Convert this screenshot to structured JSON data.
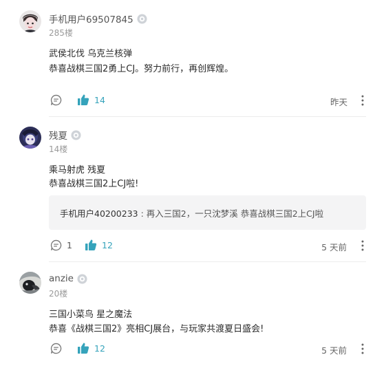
{
  "comments": [
    {
      "username": "手机用户69507845",
      "floor": "285楼",
      "lines": [
        "武侯北伐  乌克兰核弹",
        "恭喜战棋三国2勇上CJ。努力前行，再创辉煌。"
      ],
      "comment_count": "",
      "like_count": "14",
      "time": "昨天"
    },
    {
      "username": "残夏",
      "floor": "14楼",
      "lines": [
        "乘马射虎 残夏",
        "恭喜战棋三国2上CJ啦!"
      ],
      "quote": {
        "user": "手机用户40200233",
        "text": " : 再入三国2，一只沈梦溪 恭喜战棋三国2上CJ啦"
      },
      "comment_count": "1",
      "like_count": "12",
      "time": "5 天前"
    },
    {
      "username": "anzie",
      "floor": "20楼",
      "lines": [
        "三国小菜鸟  星之魔法",
        "恭喜《战棋三国2》亮相CJ展台，与玩家共渡夏日盛会!"
      ],
      "comment_count": "",
      "like_count": "12",
      "time": "5 天前"
    }
  ],
  "colors": {
    "accent": "#35a3bb",
    "divider": "#ececec",
    "quote_bg": "#f4f4f5"
  }
}
